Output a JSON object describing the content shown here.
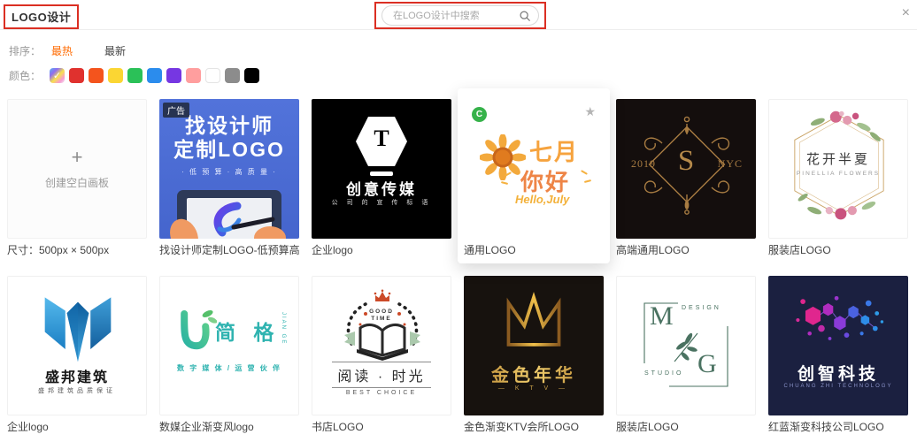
{
  "window": {
    "close_glyph": "×"
  },
  "header": {
    "title": "LOGO设计",
    "search": {
      "placeholder": "在LOGO设计中搜索"
    }
  },
  "ui_colors": {
    "annotation_red": "#db2f23",
    "sort_active_orange": "#ff6a00",
    "copyright_badge_green": "#36b24a"
  },
  "filters": {
    "sort_label": "排序：",
    "sort_options": [
      {
        "label": "最热"
      },
      {
        "label": "最新"
      }
    ],
    "color_label": "颜色：",
    "check_glyph": "✓",
    "colors": [
      {
        "name": "multicolor",
        "checked": true
      },
      {
        "name": "red",
        "hex": "#e0312e"
      },
      {
        "name": "orange",
        "hex": "#f4541d"
      },
      {
        "name": "yellow",
        "hex": "#fbd633"
      },
      {
        "name": "green",
        "hex": "#2bc158"
      },
      {
        "name": "blue",
        "hex": "#2b8ced"
      },
      {
        "name": "purple",
        "hex": "#7637e2"
      },
      {
        "name": "pink",
        "hex": "#ff9e9e"
      },
      {
        "name": "white",
        "hex": "#ffffff"
      },
      {
        "name": "gray",
        "hex": "#8c8c8c"
      },
      {
        "name": "black",
        "hex": "#000000"
      }
    ]
  },
  "cards": [
    {
      "type": "blank",
      "plus_glyph": "+",
      "label": "创建空白画板",
      "caption": "尺寸：500px × 500px"
    },
    {
      "type": "ad",
      "badge": "广告",
      "title_line1": "找设计师",
      "title_line2": "定制LOGO",
      "tagline": "· 低 预 算 · 高 质 量 ·",
      "caption": "找设计师定制LOGO-低预算高质量"
    },
    {
      "type": "media",
      "letter": "T",
      "name": "创意传媒",
      "tagline": "公 司 的 宣 传 标 语",
      "caption": "企业logo"
    },
    {
      "type": "july",
      "badge": "C",
      "star_glyph": "★",
      "word1": "七月",
      "word2": "你好",
      "word3": "Hello,July",
      "caption": "通用LOGO"
    },
    {
      "type": "monogram",
      "year": "2019",
      "letter": "S",
      "city": "NYC",
      "caption": "高端通用LOGO"
    },
    {
      "type": "floral",
      "name": "花开半夏",
      "sub": "PINELLIA FLOWERS",
      "caption": "服装店LOGO"
    },
    {
      "type": "building",
      "name": "盛邦建筑",
      "sub": "盛邦建筑品质保证",
      "caption": "企业logo"
    },
    {
      "type": "jiange",
      "name": "简 格",
      "vertical": "JIAN GE",
      "tagline": "数 字 媒 体 / 运 营 伙 伴",
      "caption": "数媒企业渐变风logo"
    },
    {
      "type": "bookstore",
      "top1": "GOOD",
      "top2": "TIME",
      "name": "阅读 · 时光",
      "sub": "BEST CHOICE",
      "caption": "书店LOGO"
    },
    {
      "type": "ktv",
      "name": "金色年华",
      "sub": "— K T V —",
      "caption": "金色渐变KTV会所LOGO"
    },
    {
      "type": "mg",
      "letter1": "M",
      "word1": "DESIGN",
      "letter2": "G",
      "word2": "STUDIO",
      "caption": "服装店LOGO"
    },
    {
      "type": "tech",
      "name": "创智科技",
      "sub": "CHUANG ZHI TECHNOLOGY",
      "caption": "红蓝渐变科技公司LOGO"
    }
  ]
}
